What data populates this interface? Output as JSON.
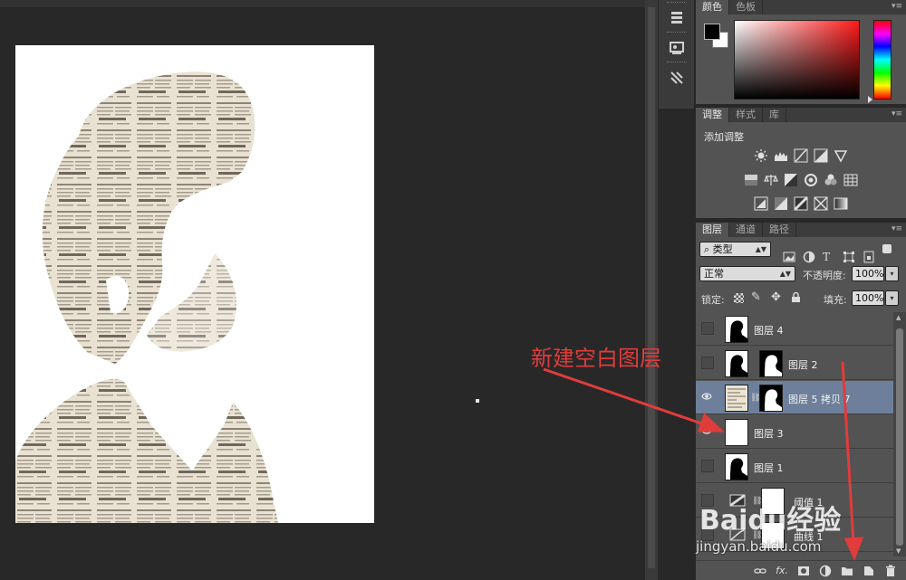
{
  "annotation": {
    "text": "新建空白图层"
  },
  "color_panel": {
    "tabs": [
      "颜色",
      "色板"
    ],
    "foreground": "#000000",
    "background": "#ffffff",
    "spectrum_hue": "#ff1a1a"
  },
  "adjustments_panel": {
    "tabs": [
      "调整",
      "样式",
      "库"
    ],
    "title": "添加调整",
    "row1_icons": [
      "brightness-contrast-icon",
      "levels-icon",
      "curves-icon",
      "exposure-icon",
      "vibrance-icon"
    ],
    "row2_icons": [
      "hue-saturation-icon",
      "color-balance-icon",
      "black-white-icon",
      "photo-filter-icon",
      "channel-mixer-icon",
      "color-lookup-icon"
    ],
    "row3_icons": [
      "invert-icon",
      "posterize-icon",
      "threshold-icon",
      "selective-color-icon",
      "gradient-map-icon"
    ]
  },
  "layers_panel": {
    "tabs": [
      "图层",
      "通道",
      "路径"
    ],
    "filter": "类型",
    "blend_mode": "正常",
    "opacity_label": "不透明度:",
    "opacity_value": "100%",
    "lock_label": "锁定:",
    "fill_label": "填充:",
    "fill_value": "100%",
    "layers": [
      {
        "name": "图层 4",
        "visible": false,
        "selected": false
      },
      {
        "name": "图层 2",
        "visible": false,
        "selected": false
      },
      {
        "name": "图层 5 拷贝 7",
        "visible": true,
        "selected": true
      },
      {
        "name": "图层 3",
        "visible": true,
        "selected": false
      },
      {
        "name": "图层 1",
        "visible": false,
        "selected": false
      },
      {
        "name": "阈值 1",
        "visible": false,
        "selected": false
      },
      {
        "name": "曲线 1",
        "visible": false,
        "selected": false
      }
    ],
    "bottom_icons": [
      "link-icon",
      "fx-icon",
      "mask-icon",
      "adjustment-layer-icon",
      "group-folder-icon",
      "new-layer-icon",
      "trash-icon"
    ],
    "fx_label": "fx."
  },
  "watermark": {
    "brand": "Baidu经验",
    "url": "jingyan.baidu.com"
  }
}
